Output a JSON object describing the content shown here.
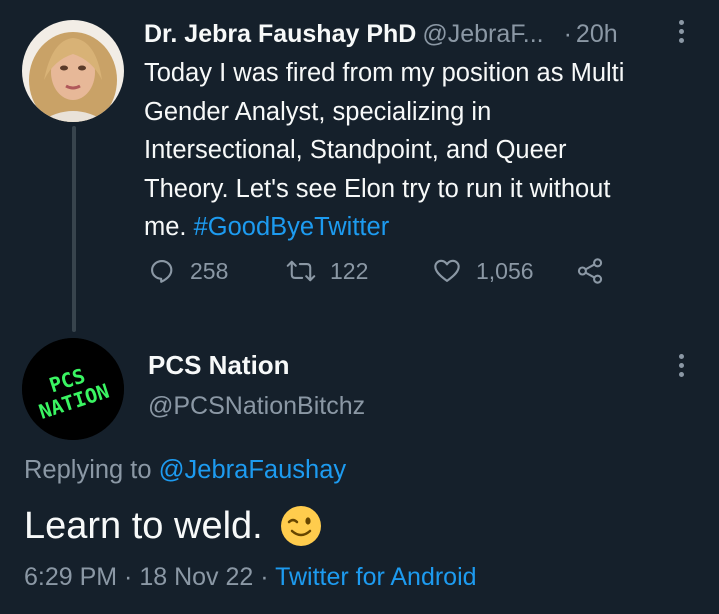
{
  "parent_tweet": {
    "author_name": "Dr. Jebra Faushay PhD",
    "handle": "@JebraF...",
    "separator": "·",
    "time": "20h",
    "text_lines": [
      "Today I was fired from my position as Multi",
      "Gender Analyst, specializing in",
      "Intersectional, Standpoint, and Queer",
      "Theory. Let's see Elon try to run it without",
      "me. "
    ],
    "hashtag": "#GoodByeTwitter",
    "replies": "258",
    "retweets": "122",
    "likes": "1,056"
  },
  "reply_tweet": {
    "author_name": "PCS Nation",
    "handle": "@PCSNationBitchz",
    "avatar_text_line1": "PCS",
    "avatar_text_line2": "NATION",
    "replying_prefix": "Replying to ",
    "replying_mention": "@JebraFaushay",
    "text": "Learn to weld.",
    "timestamp": "6:29 PM · 18 Nov 22 · ",
    "source": "Twitter for Android"
  },
  "colors": {
    "background": "#15202b",
    "text": "#f7f9f9",
    "secondary": "#8b98a5",
    "link": "#1d9bf0",
    "logo_green": "#3af562"
  }
}
